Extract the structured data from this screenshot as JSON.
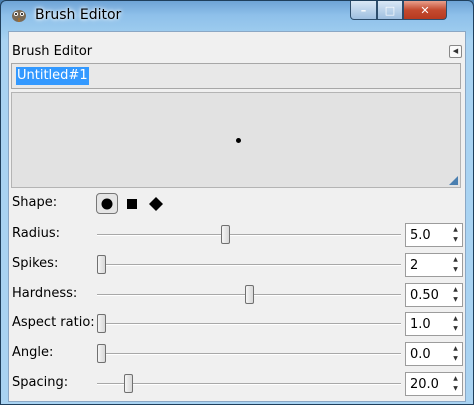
{
  "window": {
    "title": "Brush Editor",
    "controls": {
      "minimize": "–",
      "maximize": "□",
      "close": "✕"
    }
  },
  "panel": {
    "title": "Brush Editor",
    "menu_icon": "panel-menu-icon",
    "brush_name": "Untitled#1"
  },
  "shape": {
    "label": "Shape:",
    "options": [
      "circle",
      "square",
      "diamond"
    ],
    "selected": "circle"
  },
  "sliders": [
    {
      "label": "Radius:",
      "value": "5.0",
      "fraction": 0.42
    },
    {
      "label": "Spikes:",
      "value": "2",
      "fraction": 0.0
    },
    {
      "label": "Hardness:",
      "value": "0.50",
      "fraction": 0.5
    },
    {
      "label": "Aspect ratio:",
      "value": "1.0",
      "fraction": 0.0
    },
    {
      "label": "Angle:",
      "value": "0.0",
      "fraction": 0.0
    },
    {
      "label": "Spacing:",
      "value": "20.0",
      "fraction": 0.09
    }
  ]
}
